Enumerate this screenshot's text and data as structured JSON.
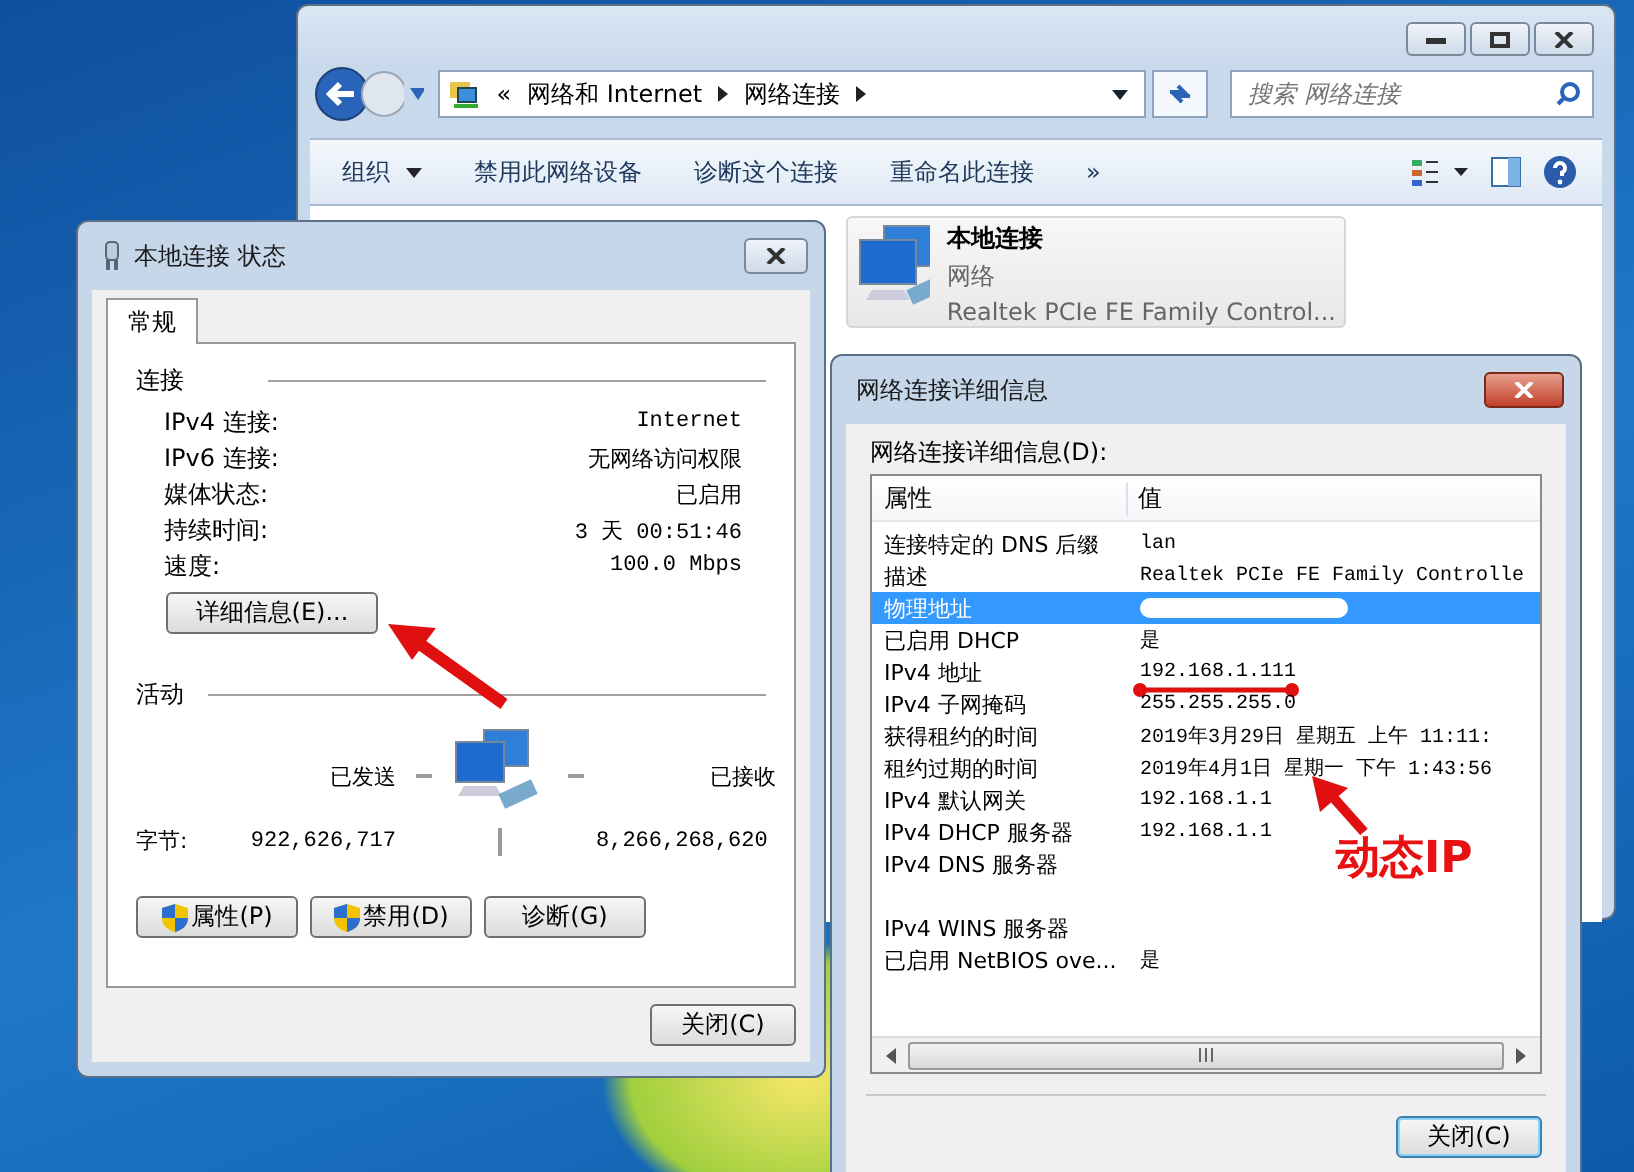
{
  "explorer": {
    "breadcrumb": {
      "overflow": "«",
      "crumbs": [
        "网络和 Internet",
        "网络连接"
      ]
    },
    "search": {
      "placeholder": "搜索 网络连接"
    },
    "toolbar": [
      {
        "label": "组织",
        "dropdown": true
      },
      {
        "label": "禁用此网络设备",
        "dropdown": false
      },
      {
        "label": "诊断这个连接",
        "dropdown": false
      },
      {
        "label": "重命名此连接",
        "dropdown": false
      }
    ],
    "more": "»",
    "adapter": {
      "name": "本地连接",
      "network": "网络",
      "device": "Realtek PCIe FE Family Control..."
    }
  },
  "status_dialog": {
    "title": "本地连接 状态",
    "tabs": [
      {
        "label": "常规",
        "selected": true
      }
    ],
    "connection": {
      "heading": "连接",
      "rows": [
        {
          "label": "IPv4 连接:",
          "value": "Internet"
        },
        {
          "label": "IPv6 连接:",
          "value": "无网络访问权限"
        },
        {
          "label": "媒体状态:",
          "value": "已启用"
        },
        {
          "label": "持续时间:",
          "value": "3 天 00:51:46"
        },
        {
          "label": "速度:",
          "value": "100.0 Mbps"
        }
      ]
    },
    "details_button": "详细信息(E)...",
    "activity": {
      "heading": "活动",
      "sent_label": "已发送",
      "received_label": "已接收",
      "bytes_label": "字节:",
      "sent": "922,626,717",
      "received": "8,266,268,620"
    },
    "buttons": [
      {
        "label": "属性(P)",
        "shield": true
      },
      {
        "label": "禁用(D)",
        "shield": true
      },
      {
        "label": "诊断(G)",
        "shield": false
      }
    ],
    "close_button": "关闭(C)"
  },
  "details_dialog": {
    "title": "网络连接详细信息",
    "list_label": "网络连接详细信息(D):",
    "columns": [
      "属性",
      "值"
    ],
    "rows": [
      {
        "kind": "row",
        "property": "连接特定的 DNS 后缀",
        "value": "lan",
        "selected": false
      },
      {
        "kind": "row",
        "property": "描述",
        "value": "Realtek PCIe FE Family Controlle",
        "selected": false
      },
      {
        "kind": "redacted",
        "property": "物理地址",
        "selected": true
      },
      {
        "kind": "row",
        "property": "已启用 DHCP",
        "value": "是",
        "selected": false
      },
      {
        "kind": "row",
        "property": "IPv4 地址",
        "value": "192.168.1.111",
        "selected": false,
        "underlined": true
      },
      {
        "kind": "row",
        "property": "IPv4 子网掩码",
        "value": "255.255.255.0",
        "selected": false
      },
      {
        "kind": "row",
        "property": "获得租约的时间",
        "value": "2019年3月29日 星期五 上午 11:11:",
        "selected": false
      },
      {
        "kind": "row",
        "property": "租约过期的时间",
        "value": "2019年4月1日 星期一 下午 1:43:56",
        "selected": false
      },
      {
        "kind": "row",
        "property": "IPv4 默认网关",
        "value": "192.168.1.1",
        "selected": false
      },
      {
        "kind": "row",
        "property": "IPv4 DHCP 服务器",
        "value": "192.168.1.1",
        "selected": false
      },
      {
        "kind": "row",
        "property": "IPv4 DNS 服务器",
        "selected": false
      },
      {
        "kind": "blank"
      },
      {
        "kind": "row",
        "property": "IPv4 WINS 服务器",
        "selected": false
      },
      {
        "kind": "row",
        "property": "已启用 NetBIOS ove...",
        "value": "是",
        "selected": false
      }
    ],
    "close_button": "关闭(C)"
  },
  "annotation_label": "动态IP"
}
